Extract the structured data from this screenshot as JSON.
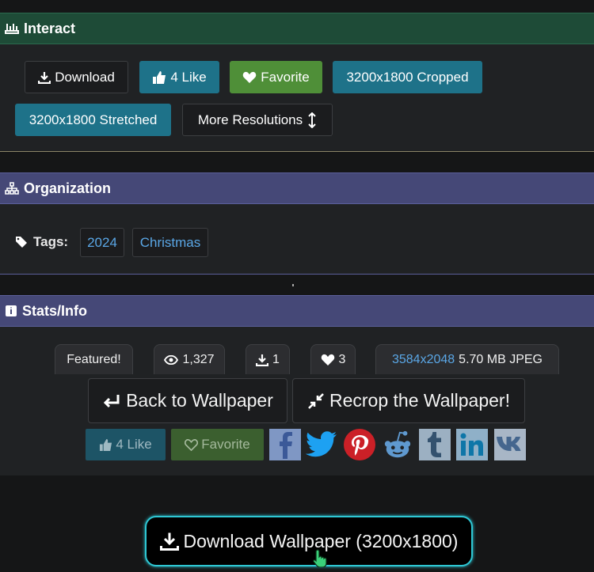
{
  "interact": {
    "title": "Interact",
    "buttons": {
      "download": "Download",
      "like": "4 Like",
      "favorite": "Favorite",
      "cropped": "3200x1800 Cropped",
      "stretched": "3200x1800 Stretched",
      "more_resolutions": "More Resolutions"
    }
  },
  "organization": {
    "title": "Organization",
    "tags_label": "Tags:",
    "tags": [
      "2024",
      "Christmas"
    ]
  },
  "stats": {
    "title": "Stats/Info",
    "featured": "Featured!",
    "views": "1,327",
    "downloads": "1",
    "likes": "3",
    "resolution": "3584x2048",
    "file_info": "5.70 MB JPEG"
  },
  "actions": {
    "back": "Back to Wallpaper",
    "recrop": "Recrop the Wallpaper!",
    "like": "4 Like",
    "favorite": "Favorite",
    "social": [
      "facebook",
      "twitter",
      "pinterest",
      "reddit",
      "tumblr",
      "linkedin",
      "vk"
    ]
  },
  "download_main": "Download Wallpaper (3200x1800)",
  "colors": {
    "teal": "#1e7289",
    "green": "#4f8f38",
    "link": "#5aa7e6",
    "highlight": "#2ec7d4"
  }
}
